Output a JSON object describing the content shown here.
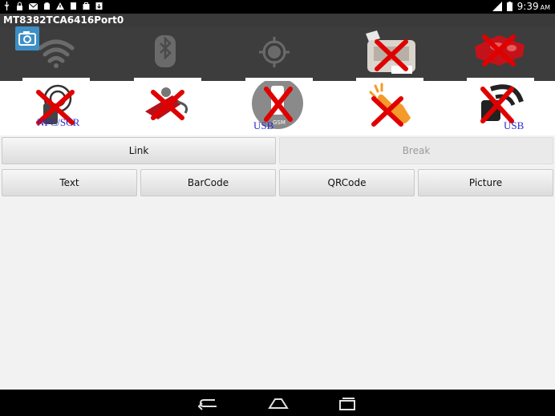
{
  "status_bar": {
    "time": "9:39",
    "ampm": "AM",
    "left_icons": [
      "usb-icon",
      "lock-icon",
      "gmail-icon",
      "android-icon",
      "warning-icon",
      "storage-icon",
      "bag-icon",
      "download-icon"
    ],
    "right_icons": [
      "signal-icon",
      "battery-icon"
    ]
  },
  "app": {
    "title": "MT8382TCA6416Port0"
  },
  "icon_row_1": [
    {
      "name": "wifi",
      "state": "disabled"
    },
    {
      "name": "bluetooth",
      "state": "disabled"
    },
    {
      "name": "gps",
      "state": "disabled"
    },
    {
      "name": "printer",
      "state": "failed"
    },
    {
      "name": "remote",
      "state": "failed"
    }
  ],
  "icon_row_2": [
    {
      "name": "nfc-scr",
      "state": "failed",
      "label": "NFC/SCR"
    },
    {
      "name": "hand-scan",
      "state": "failed",
      "label": ""
    },
    {
      "name": "gsm-usb",
      "state": "failed",
      "label": "USB",
      "sublabel": "GSM"
    },
    {
      "name": "touch",
      "state": "failed",
      "label": ""
    },
    {
      "name": "scanner-usb",
      "state": "failed",
      "label": "USB"
    }
  ],
  "buttons": {
    "link": "Link",
    "break": "Break",
    "text": "Text",
    "barcode": "BarCode",
    "qrcode": "QRCode",
    "picture": "Picture"
  },
  "colors": {
    "accent_blue": "#3d8fc6",
    "fail_red": "#e00000",
    "usb_text": "#2b2bcf"
  }
}
